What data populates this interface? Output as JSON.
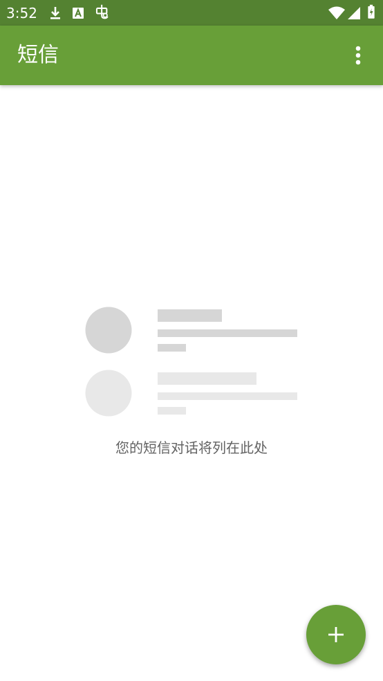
{
  "status_bar": {
    "time": "3:52",
    "left_icons": [
      "download-icon",
      "font-a-icon",
      "app-notification-icon"
    ],
    "right_icons": [
      "wifi-icon",
      "cell-signal-icon",
      "battery-icon"
    ],
    "background": "#548231"
  },
  "app_bar": {
    "title": "短信",
    "menu_icon": "more-vert-icon",
    "background": "#689f38"
  },
  "empty_state": {
    "message": "您的短信对话将列在此处"
  },
  "fab": {
    "icon": "plus-icon",
    "color": "#689f38"
  }
}
